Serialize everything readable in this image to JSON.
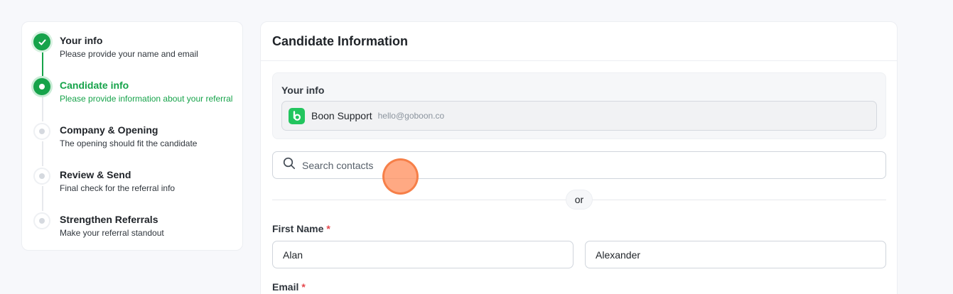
{
  "steps": [
    {
      "title": "Your info",
      "subtitle": "Please provide your name and email",
      "state": "done"
    },
    {
      "title": "Candidate info",
      "subtitle": "Please provide information about your referral",
      "state": "active"
    },
    {
      "title": "Company & Opening",
      "subtitle": "The opening should fit the candidate",
      "state": "pending"
    },
    {
      "title": "Review & Send",
      "subtitle": "Final check for the referral info",
      "state": "pending"
    },
    {
      "title": "Strengthen Referrals",
      "subtitle": "Make your referral standout",
      "state": "pending"
    }
  ],
  "main": {
    "title": "Candidate Information",
    "your_info": {
      "label": "Your info",
      "name": "Boon Support",
      "email": "hello@goboon.co"
    },
    "search": {
      "placeholder": "Search contacts"
    },
    "or_label": "or",
    "first_name": {
      "label": "First Name",
      "required": "*",
      "first_value": "Alan",
      "last_value": "Alexander"
    },
    "email": {
      "label": "Email",
      "required": "*"
    }
  },
  "colors": {
    "accent": "#16a34a",
    "brand_logo": "#22c55e",
    "required": "#e5484d"
  }
}
